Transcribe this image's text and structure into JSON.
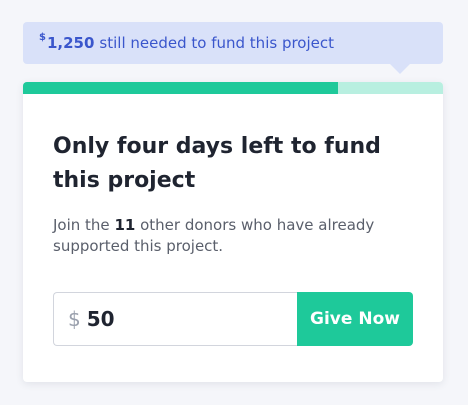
{
  "tooltip": {
    "currency_symbol": "$",
    "amount": "1,250",
    "message": "still needed to fund this project"
  },
  "progress": {
    "funded_fraction": 0.75,
    "fill_color": "#1ec99a",
    "track_color": "#b8efe0"
  },
  "card": {
    "title": "Only four days left to fund this project",
    "subtitle_prefix": "Join the",
    "donor_count": "11",
    "subtitle_suffix": "other donors who have already supported this project."
  },
  "donation": {
    "currency_symbol": "$",
    "amount_value": "50",
    "button_label": "Give Now"
  },
  "colors": {
    "accent": "#1ec99a",
    "tooltip_bg": "#d9e1f9",
    "tooltip_text": "#3a56cc"
  }
}
